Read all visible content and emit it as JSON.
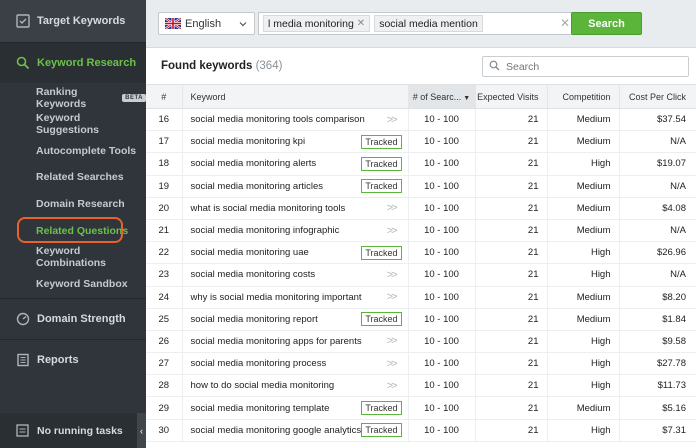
{
  "sidebar": {
    "target_keywords": "Target Keywords",
    "keyword_research": "Keyword Research",
    "sub_items": [
      {
        "label": "Ranking Keywords",
        "badge": "BETA"
      },
      {
        "label": "Keyword Suggestions"
      },
      {
        "label": "Autocomplete Tools"
      },
      {
        "label": "Related Searches"
      },
      {
        "label": "Domain Research"
      },
      {
        "label": "Related Questions"
      },
      {
        "label": "Keyword Combinations"
      },
      {
        "label": "Keyword Sandbox"
      }
    ],
    "domain_strength": "Domain Strength",
    "reports": "Reports",
    "tasks": "No running tasks",
    "accent_color": "#6cc14a",
    "highlight_color": "#e8622a"
  },
  "topbar": {
    "language": "English",
    "chips": [
      "l media monitoring",
      "social media mention"
    ],
    "search_label": "Search",
    "search_color": "#5ab53a"
  },
  "found": {
    "title": "Found keywords",
    "count": "(364)",
    "search_placeholder": "Search"
  },
  "table": {
    "headers": {
      "num": "#",
      "keyword": "Keyword",
      "searches": "# of Searc...",
      "visits": "Expected Visits",
      "competition": "Competition",
      "cpc": "Cost Per Click"
    },
    "tracked_label": "Tracked",
    "rows": [
      {
        "n": "16",
        "kw": "social media monitoring tools comparison",
        "tracked": false,
        "sv": "10 - 100",
        "ev": "21",
        "co": "Medium",
        "cpc": "$37.54"
      },
      {
        "n": "17",
        "kw": "social media monitoring kpi",
        "tracked": true,
        "sv": "10 - 100",
        "ev": "21",
        "co": "Medium",
        "cpc": "N/A"
      },
      {
        "n": "18",
        "kw": "social media monitoring alerts",
        "tracked": true,
        "sv": "10 - 100",
        "ev": "21",
        "co": "High",
        "cpc": "$19.07"
      },
      {
        "n": "19",
        "kw": "social media monitoring articles",
        "tracked": true,
        "sv": "10 - 100",
        "ev": "21",
        "co": "Medium",
        "cpc": "N/A"
      },
      {
        "n": "20",
        "kw": "what is social media monitoring tools",
        "tracked": false,
        "sv": "10 - 100",
        "ev": "21",
        "co": "Medium",
        "cpc": "$4.08"
      },
      {
        "n": "21",
        "kw": "social media monitoring infographic",
        "tracked": false,
        "sv": "10 - 100",
        "ev": "21",
        "co": "Medium",
        "cpc": "N/A"
      },
      {
        "n": "22",
        "kw": "social media monitoring uae",
        "tracked": true,
        "sv": "10 - 100",
        "ev": "21",
        "co": "High",
        "cpc": "$26.96"
      },
      {
        "n": "23",
        "kw": "social media monitoring costs",
        "tracked": false,
        "sv": "10 - 100",
        "ev": "21",
        "co": "High",
        "cpc": "N/A"
      },
      {
        "n": "24",
        "kw": "why is social media monitoring important",
        "tracked": false,
        "sv": "10 - 100",
        "ev": "21",
        "co": "Medium",
        "cpc": "$8.20"
      },
      {
        "n": "25",
        "kw": "social media monitoring report",
        "tracked": true,
        "sv": "10 - 100",
        "ev": "21",
        "co": "Medium",
        "cpc": "$1.84"
      },
      {
        "n": "26",
        "kw": "social media monitoring apps for parents",
        "tracked": false,
        "sv": "10 - 100",
        "ev": "21",
        "co": "High",
        "cpc": "$9.58"
      },
      {
        "n": "27",
        "kw": "social media monitoring process",
        "tracked": false,
        "sv": "10 - 100",
        "ev": "21",
        "co": "High",
        "cpc": "$27.78"
      },
      {
        "n": "28",
        "kw": "how to do social media monitoring",
        "tracked": false,
        "sv": "10 - 100",
        "ev": "21",
        "co": "High",
        "cpc": "$11.73"
      },
      {
        "n": "29",
        "kw": "social media monitoring template",
        "tracked": true,
        "sv": "10 - 100",
        "ev": "21",
        "co": "Medium",
        "cpc": "$5.16"
      },
      {
        "n": "30",
        "kw": "social media monitoring google analytics",
        "tracked": true,
        "sv": "10 - 100",
        "ev": "21",
        "co": "High",
        "cpc": "$7.31"
      }
    ]
  }
}
